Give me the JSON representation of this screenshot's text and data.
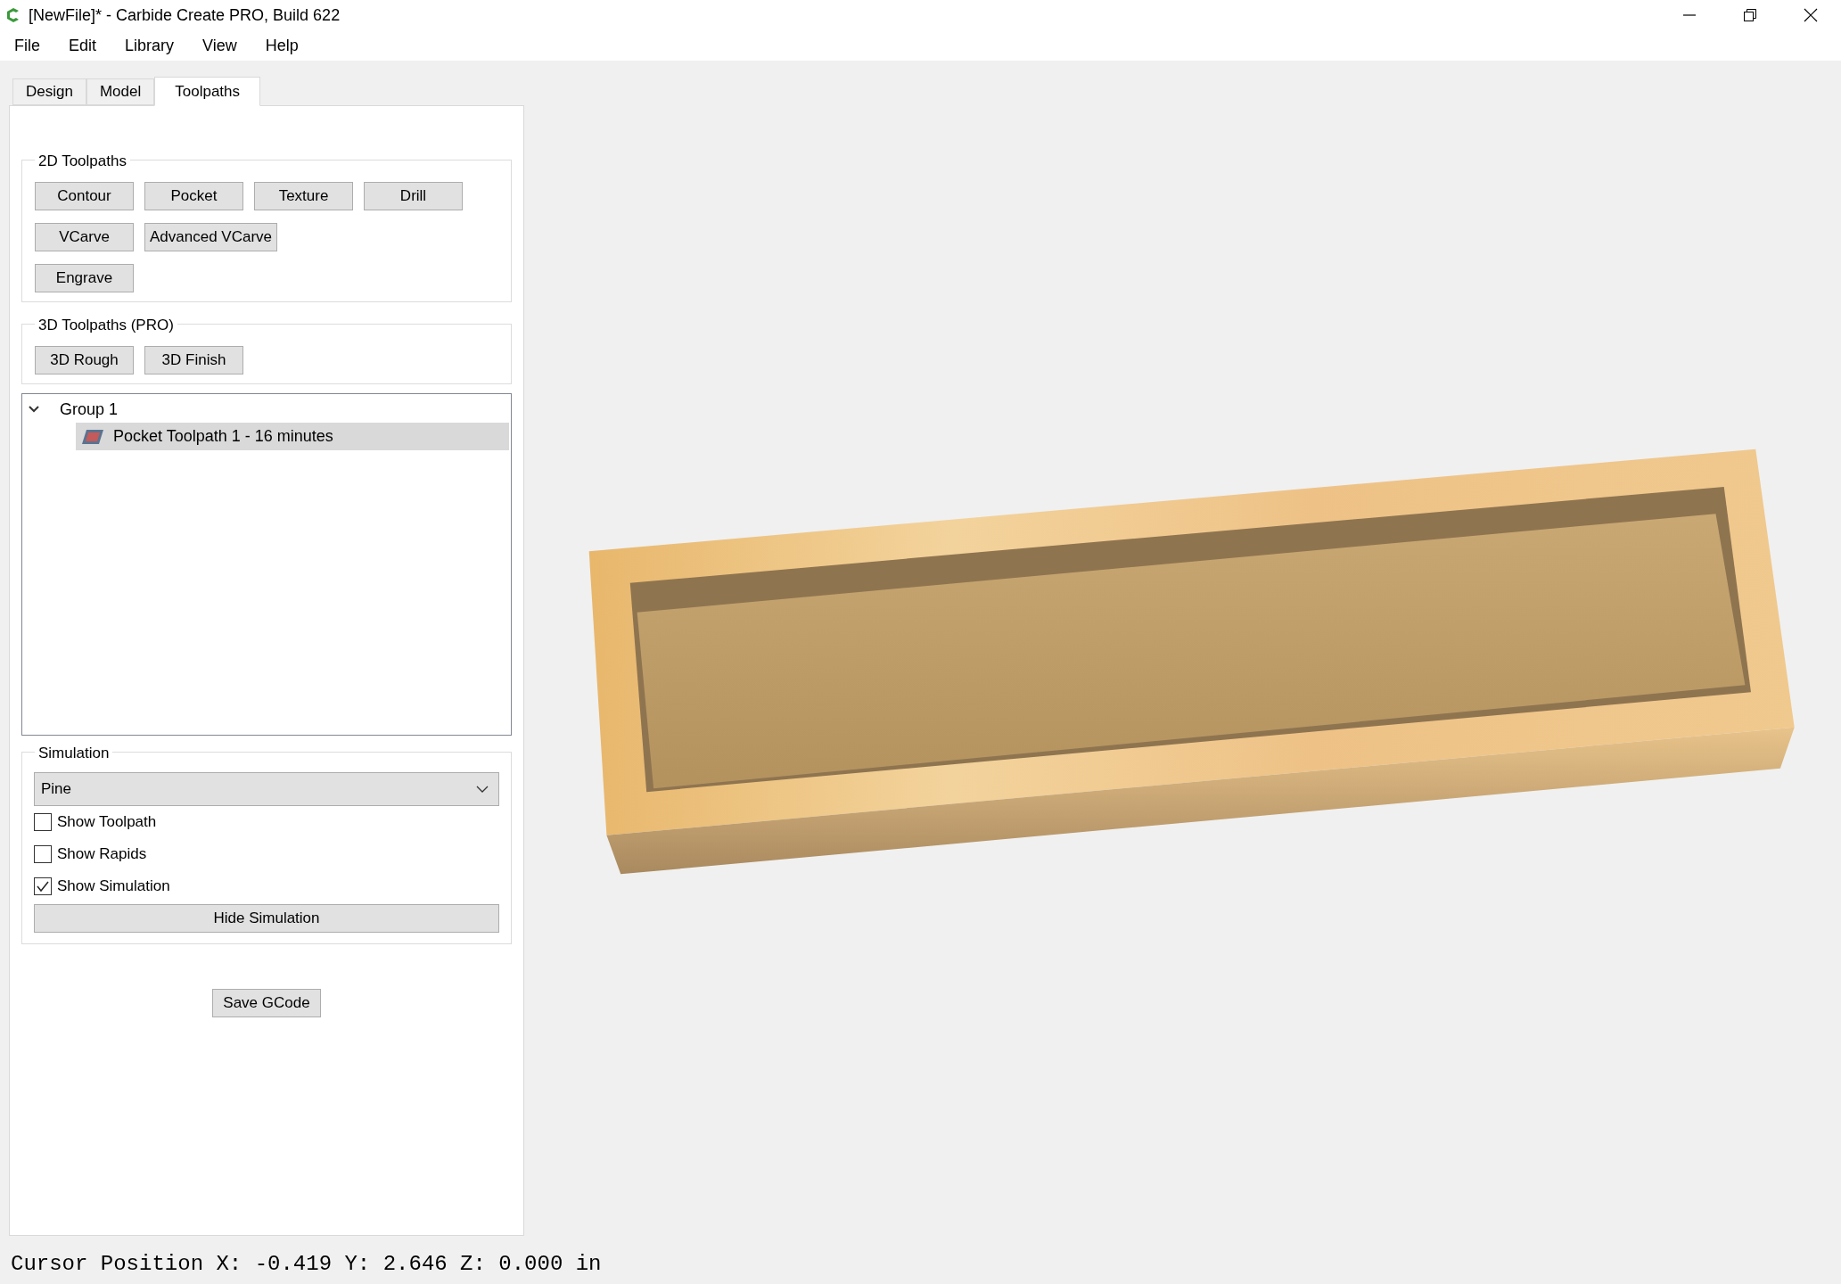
{
  "window": {
    "title": "[NewFile]* - Carbide Create PRO, Build 622"
  },
  "menu": [
    "File",
    "Edit",
    "Library",
    "View",
    "Help"
  ],
  "tabs": [
    {
      "label": "Design",
      "selected": false
    },
    {
      "label": "Model",
      "selected": false
    },
    {
      "label": "Toolpaths",
      "selected": true
    }
  ],
  "toolpaths_2d": {
    "title": "2D Toolpaths",
    "rows": [
      [
        "Contour",
        "Pocket",
        "Texture",
        "Drill"
      ],
      [
        "VCarve",
        "Advanced VCarve"
      ],
      [
        "Engrave"
      ]
    ]
  },
  "toolpaths_3d": {
    "title": "3D Toolpaths (PRO)",
    "rows": [
      [
        "3D Rough",
        "3D Finish"
      ]
    ]
  },
  "tree": [
    {
      "label": "Group 1",
      "expanded": true,
      "children": [
        {
          "label": "Pocket Toolpath 1 - 16 minutes",
          "selected": true
        }
      ]
    }
  ],
  "simulation": {
    "title": "Simulation",
    "material": "Pine",
    "options": [
      {
        "label": "Show Toolpath",
        "checked": false
      },
      {
        "label": "Show Rapids",
        "checked": false
      },
      {
        "label": "Show Simulation",
        "checked": true
      }
    ],
    "button": "Hide Simulation"
  },
  "save_button": "Save GCode",
  "status_bar": "Cursor Position X: -0.419 Y: 2.646 Z: 0.000 in"
}
